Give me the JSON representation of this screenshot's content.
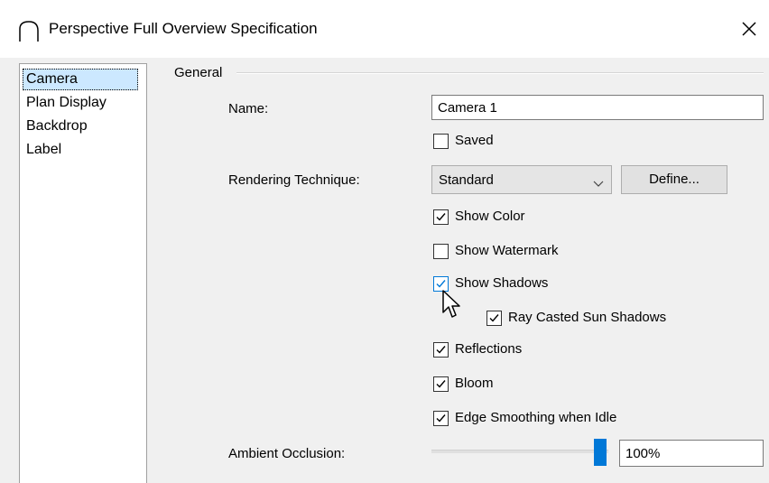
{
  "window": {
    "title": "Perspective Full Overview Specification",
    "icon": "camera-arch-icon",
    "close_icon": "close-icon"
  },
  "nav": {
    "items": [
      {
        "label": "Camera",
        "selected": true
      },
      {
        "label": "Plan Display",
        "selected": false
      },
      {
        "label": "Backdrop",
        "selected": false
      },
      {
        "label": "Label",
        "selected": false
      }
    ]
  },
  "general": {
    "group_label": "General",
    "name_label": "Name:",
    "name_value": "Camera 1",
    "saved_label": "Saved",
    "saved_checked": false,
    "rendering_label": "Rendering Technique:",
    "rendering_value": "Standard",
    "define_label": "Define...",
    "show_color_label": "Show Color",
    "show_color_checked": true,
    "show_watermark_label": "Show Watermark",
    "show_watermark_checked": false,
    "show_shadows_label": "Show Shadows",
    "show_shadows_checked": true,
    "ray_casted_label": "Ray Casted Sun Shadows",
    "ray_casted_checked": true,
    "reflections_label": "Reflections",
    "reflections_checked": true,
    "bloom_label": "Bloom",
    "bloom_checked": true,
    "edge_smoothing_label": "Edge Smoothing when Idle",
    "edge_smoothing_checked": true,
    "ambient_label": "Ambient Occlusion:",
    "ambient_value": "100%",
    "ambient_level": 1.0
  },
  "colors": {
    "accent": "#0078d7",
    "selection": "#cce8ff"
  }
}
